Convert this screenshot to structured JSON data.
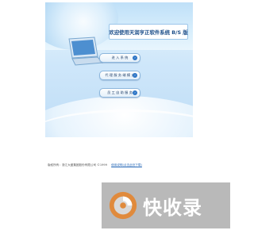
{
  "login": {
    "title": "欢迎使用天润亨正软件系统 B/S 版",
    "buttons": [
      {
        "label": "进 入 系 统"
      },
      {
        "label": "代 理 服 务 端 模 式"
      },
      {
        "label": "员 工 自 助 服 务"
      }
    ]
  },
  "footer": {
    "copyright": "版权所有：浙江大盛集团股份有限公司 ©1999",
    "link": "使用说明(点击此处下载)"
  },
  "watermark": {
    "text": "快收录"
  }
}
